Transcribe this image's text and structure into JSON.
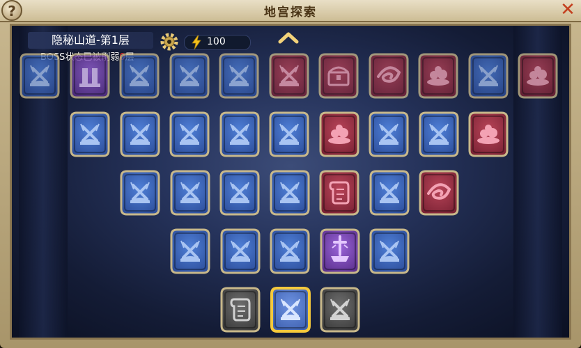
{
  "header": {
    "title": "地宫探索",
    "help_label": "?",
    "close_label": "✕"
  },
  "info": {
    "level_name": "隐秘山道-第1层",
    "boss_prefix": "BOSS状态已被削弱",
    "boss_count": "0",
    "boss_suffix": "层",
    "energy": "100"
  },
  "colors": {
    "blue": "#5b86d8",
    "red": "#b8465a",
    "purple": "#8a5ad0",
    "grey": "#6a6a6a",
    "gold": "#f5c93c"
  },
  "rows": [
    [
      "fight",
      "boss",
      "fight",
      "fight",
      "fight",
      "fight",
      "chest",
      "vortex",
      "treasure",
      "fight",
      "treasure"
    ],
    [
      "fight",
      "fight",
      "fight",
      "fight",
      "fight",
      "treasure",
      "fight",
      "fight",
      "treasure"
    ],
    [
      "fight",
      "fight",
      "fight",
      "fight",
      "scroll",
      "fight",
      "vortex"
    ],
    [
      "fight",
      "fight",
      "fight",
      "altar",
      "fight"
    ],
    [
      "scroll",
      "fight",
      "fight"
    ]
  ],
  "row_states": [
    [
      "blue",
      "purple",
      "blue",
      "blue",
      "blue",
      "red",
      "red",
      "red",
      "red",
      "blue",
      "red"
    ],
    [
      "blue",
      "blue",
      "blue",
      "blue",
      "blue",
      "red",
      "blue",
      "blue",
      "red"
    ],
    [
      "blue",
      "blue",
      "blue",
      "blue",
      "red",
      "blue",
      "red"
    ],
    [
      "blue",
      "blue",
      "blue",
      "purple",
      "blue"
    ],
    [
      "grey",
      "current",
      "grey"
    ]
  ]
}
